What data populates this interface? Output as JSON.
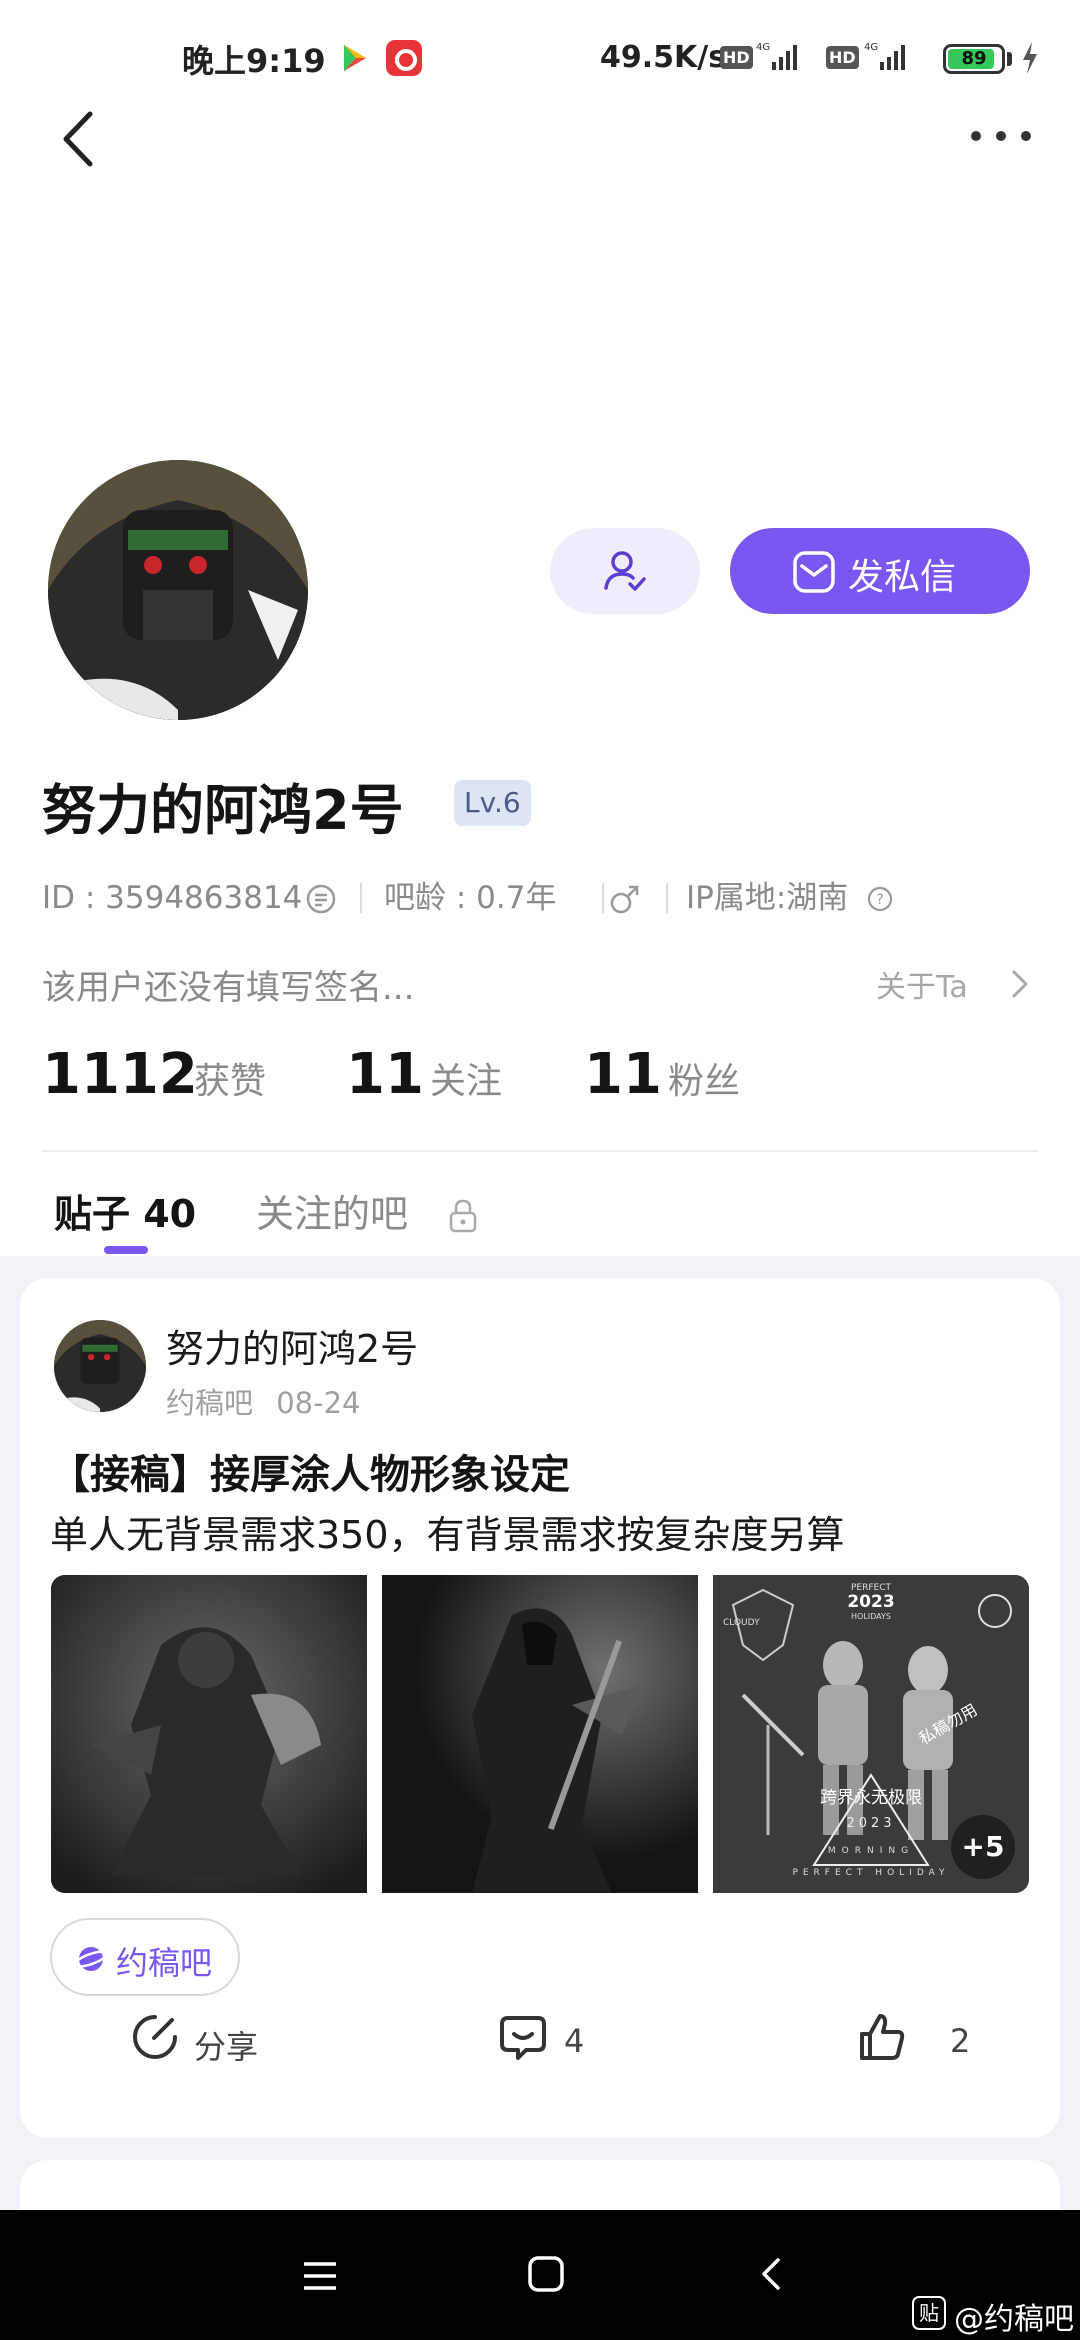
{
  "status_bar": {
    "time": "晚上9:19",
    "net_speed": "49.5K/s",
    "hd1": "HD",
    "hd2": "HD",
    "battery": "89",
    "battery_level": 0.89,
    "battery_color": "#34c759"
  },
  "nav": {
    "back_icon": "chevron-left-icon",
    "more_icon": "more-dots-icon"
  },
  "profile": {
    "username": "努力的阿鸿2号",
    "level": "Lv.6",
    "id_text": "ID : 3594863814",
    "age_text": "吧龄 : 0.7年",
    "gender_icon": "male-icon",
    "ip_text": "IP属地:湖南",
    "signature": "该用户还没有填写签名...",
    "about": "关于Ta",
    "follow_button_icon": "user-check-icon",
    "message_button": "发私信",
    "accent_color": "#7a57f0"
  },
  "stats": [
    {
      "value": "1112",
      "label": "获赞"
    },
    {
      "value": "11",
      "label": "关注"
    },
    {
      "value": "11",
      "label": "粉丝"
    }
  ],
  "tabs": [
    {
      "label": "贴子 40",
      "active": true
    },
    {
      "label": "关注的吧",
      "active": false,
      "locked": true
    }
  ],
  "post": {
    "author": "努力的阿鸿2号",
    "forum": "约稿吧",
    "date": "08-24",
    "title": "【接稿】接厚涂人物形象设定",
    "body": "单人无背景需求350，有背景需求按复杂度另算",
    "thumbnail3_texts": {
      "brand": "CLOUDY",
      "perfect": "PERFECT",
      "year": "2023",
      "holidays": "HOLIDAYS",
      "watermark": "私稿勿用",
      "slogan": "跨界永无极限",
      "year2": "2023",
      "morning": "MORNING",
      "footer": "PERFECT HOLIDAY"
    },
    "more_images": "+5",
    "forum_tag": "约稿吧",
    "actions": {
      "share": "分享",
      "comments": "4",
      "likes": "2"
    }
  },
  "bottom_nav": {
    "menu_icon": "menu-icon",
    "home_icon": "home-square-icon",
    "back_icon": "back-triangle-icon",
    "watermark_icon": "贴",
    "watermark": "@约稿吧"
  }
}
